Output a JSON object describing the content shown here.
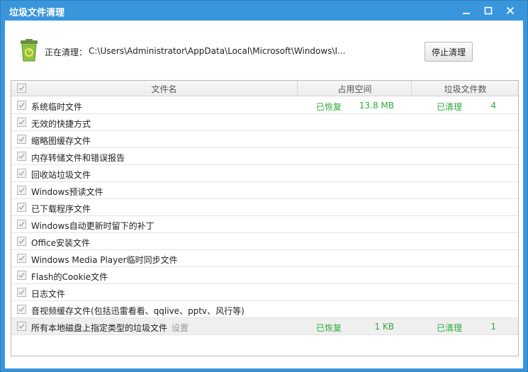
{
  "window": {
    "title": "垃圾文件清理",
    "controls": {
      "minimize": "minimize-icon",
      "maximize": "maximize-icon",
      "close": "close-icon"
    }
  },
  "status": {
    "label": "正在清理：",
    "path": "C:\\Users\\Administrator\\AppData\\Local\\Microsoft\\Windows\\I...",
    "stop_button": "停止清理",
    "icon": "recycle-bin-icon"
  },
  "table": {
    "headers": {
      "name": "文件名",
      "space": "占用空间",
      "count": "垃圾文件数"
    },
    "rows": [
      {
        "name": "系统临时文件",
        "restored": "已恢复",
        "size": "13.8 MB",
        "cleaned": "已清理",
        "count": "4"
      },
      {
        "name": "无效的快捷方式"
      },
      {
        "name": "缩略图缓存文件"
      },
      {
        "name": "内存转储文件和错误报告"
      },
      {
        "name": "回收站垃圾文件"
      },
      {
        "name": "Windows预读文件"
      },
      {
        "name": "已下载程序文件"
      },
      {
        "name": "Windows自动更新时留下的补丁"
      },
      {
        "name": "Office安装文件"
      },
      {
        "name": "Windows Media Player临时同步文件"
      },
      {
        "name": "Flash的Cookie文件"
      },
      {
        "name": "日志文件"
      },
      {
        "name": "音视频缓存文件(包括迅雷看看、qqlive、pptv、风行等)"
      },
      {
        "name": "所有本地磁盘上指定类型的垃圾文件",
        "setting": "设置",
        "restored": "已恢复",
        "size": "1 KB",
        "cleaned": "已清理",
        "count": "1"
      }
    ]
  },
  "colors": {
    "titlebar": "#3a96dc",
    "status_green": "#2eaa38",
    "highlight_row": "#efefef"
  }
}
